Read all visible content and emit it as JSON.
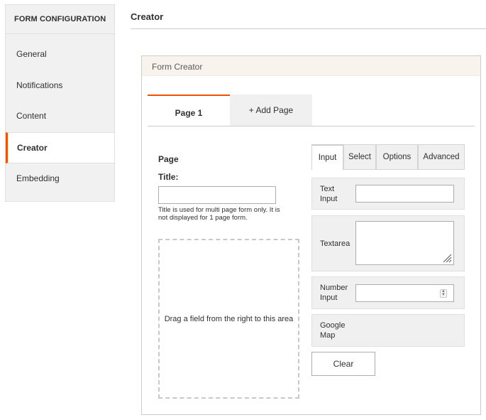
{
  "sidebar": {
    "header": "FORM CONFIGURATION",
    "items": [
      {
        "label": "General"
      },
      {
        "label": "Notifications"
      },
      {
        "label": "Content"
      },
      {
        "label": "Creator",
        "active": true
      },
      {
        "label": "Embedding"
      }
    ]
  },
  "page": {
    "title": "Creator"
  },
  "panel": {
    "title": "Form Creator",
    "page_tabs": [
      {
        "label": "Page 1",
        "active": true
      },
      {
        "label": "+ Add Page"
      }
    ],
    "page_section": {
      "heading": "Page",
      "title_label": "Title:",
      "title_value": "",
      "hint": "Title is used for multi page form only. It is not displayed for 1 page form.",
      "dropzone_text": "Drag a field from the right to this area"
    },
    "palette_tabs": [
      {
        "label": "Input",
        "active": true
      },
      {
        "label": "Select"
      },
      {
        "label": "Options"
      },
      {
        "label": "Advanced"
      }
    ],
    "fields": {
      "text_input": {
        "line1": "Text",
        "line2": "Input"
      },
      "textarea": {
        "label": "Textarea"
      },
      "number_input": {
        "line1": "Number",
        "line2": "Input"
      },
      "google_map": {
        "line1": "Google",
        "line2": "Map"
      }
    },
    "clear_label": "Clear"
  },
  "colors": {
    "accent": "#eb5202",
    "panel_header_bg": "#f8f3ec",
    "sidebar_bg": "#f1f1f1"
  },
  "icons": [
    "resize-grip-icon",
    "number-spinner-icon"
  ]
}
